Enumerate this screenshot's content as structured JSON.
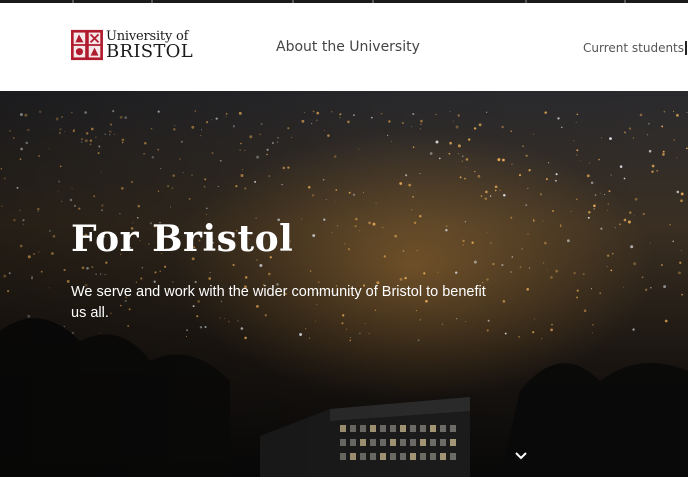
{
  "header": {
    "logo": {
      "line1": "University of",
      "line2": "BRISTOL"
    },
    "nav_primary": "About the University",
    "nav_secondary": "Current students"
  },
  "hero": {
    "title": "For Bristol",
    "subtitle": "We serve and work with the wider community of Bristol to benefit us all."
  },
  "colors": {
    "brand_red": "#b01c2e",
    "text_dark": "#1b1b1b",
    "nav_text": "#444444"
  },
  "icons": {
    "logo_crest": "university-crest-icon",
    "scroll": "chevron-down-icon"
  }
}
